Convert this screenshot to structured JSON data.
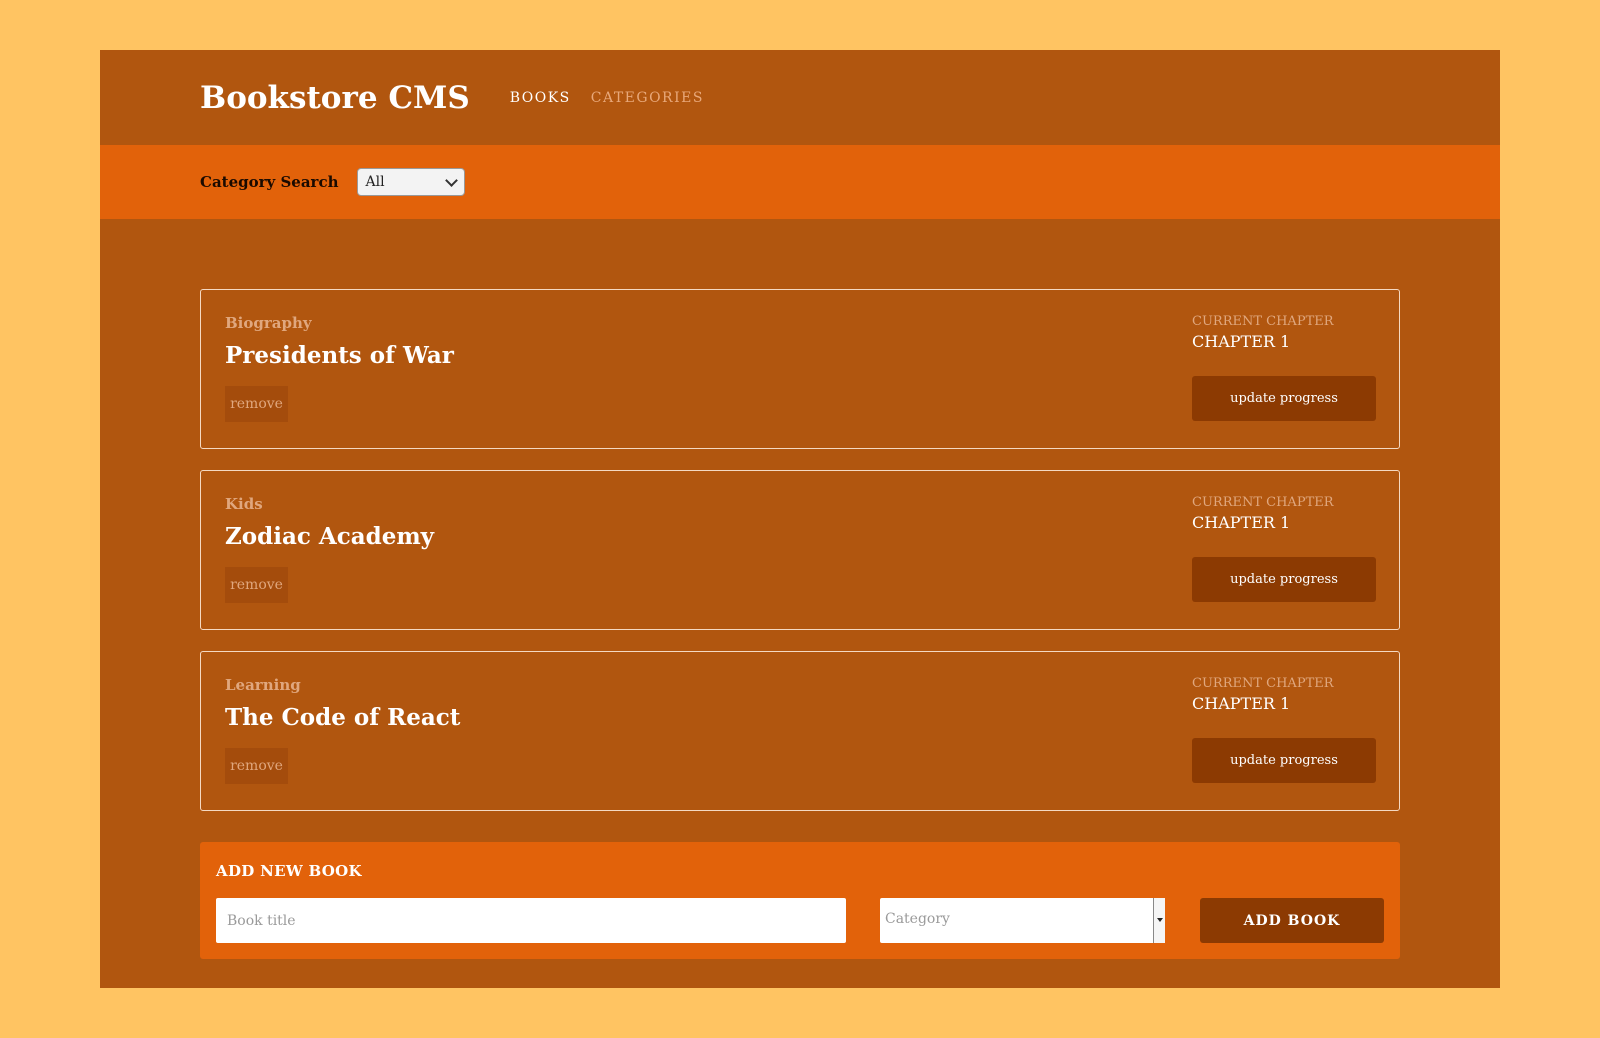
{
  "header": {
    "brand": "Bookstore CMS",
    "nav": [
      {
        "label": "BOOKS",
        "active": true
      },
      {
        "label": "CATEGORIES",
        "active": false
      }
    ]
  },
  "filter": {
    "label": "Category Search",
    "selected": "All"
  },
  "books": [
    {
      "category": "Biography",
      "title": "Presidents of War",
      "remove_label": "remove",
      "chapter_caption": "CURRENT CHAPTER",
      "chapter": "CHAPTER 1",
      "update_label": "update progress"
    },
    {
      "category": "Kids",
      "title": "Zodiac Academy",
      "remove_label": "remove",
      "chapter_caption": "CURRENT CHAPTER",
      "chapter": "CHAPTER 1",
      "update_label": "update progress"
    },
    {
      "category": "Learning",
      "title": "The Code of React",
      "remove_label": "remove",
      "chapter_caption": "CURRENT CHAPTER",
      "chapter": "CHAPTER 1",
      "update_label": "update progress"
    }
  ],
  "add_form": {
    "heading": "ADD NEW BOOK",
    "title_placeholder": "Book title",
    "category_placeholder": "Category",
    "submit_label": "ADD BOOK"
  },
  "colors": {
    "page_bg": "#ffc462",
    "app_bg": "#b1560f",
    "accent": "#e2620a",
    "button_dark": "#8c3a02",
    "muted_text": "#e0a77e"
  }
}
